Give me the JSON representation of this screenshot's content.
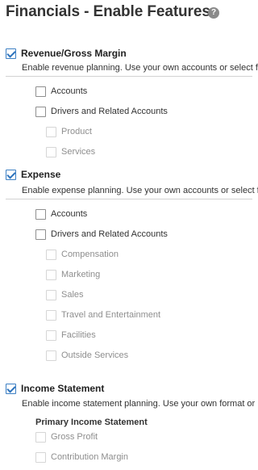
{
  "page": {
    "title": "Financials - Enable Features",
    "help_icon": "help-icon"
  },
  "revenue": {
    "label": "Revenue/Gross Margin",
    "checked": true,
    "description": "Enable revenue planning. Use your own accounts or select fro",
    "options": [
      {
        "label": "Accounts",
        "checked": false,
        "enabled": true
      },
      {
        "label": "Drivers and Related Accounts",
        "checked": false,
        "enabled": true
      }
    ],
    "sub_options": [
      {
        "label": "Product",
        "enabled": false
      },
      {
        "label": "Services",
        "enabled": false
      }
    ]
  },
  "expense": {
    "label": "Expense",
    "checked": true,
    "description": "Enable expense planning. Use your own accounts or select fro",
    "options": [
      {
        "label": "Accounts",
        "checked": false,
        "enabled": true
      },
      {
        "label": "Drivers and Related Accounts",
        "checked": false,
        "enabled": true
      }
    ],
    "sub_options": [
      {
        "label": "Compensation",
        "enabled": false
      },
      {
        "label": "Marketing",
        "enabled": false
      },
      {
        "label": "Sales",
        "enabled": false
      },
      {
        "label": "Travel and Entertainment",
        "enabled": false
      },
      {
        "label": "Facilities",
        "enabled": false
      },
      {
        "label": "Outside Services",
        "enabled": false
      }
    ]
  },
  "income": {
    "label": "Income Statement",
    "checked": true,
    "description": "Enable income statement planning. Use your own format or",
    "subheading": "Primary Income Statement",
    "options": [
      {
        "label": "Gross Profit",
        "enabled": false
      },
      {
        "label": "Contribution Margin",
        "enabled": false
      }
    ]
  },
  "colors": {
    "accent": "#2e74bd",
    "text": "#333333",
    "disabled_text": "#8e8e8e",
    "divider": "#d2d2d2"
  }
}
